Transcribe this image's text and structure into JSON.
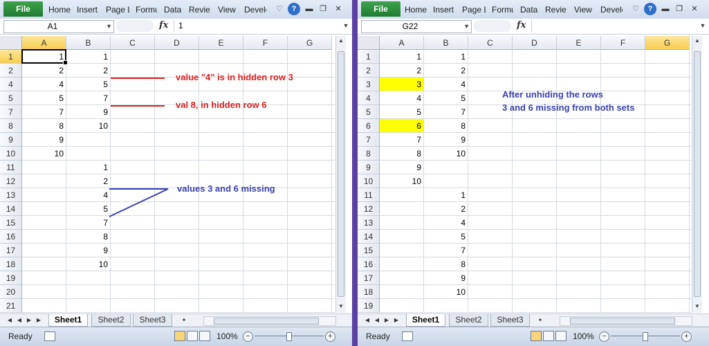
{
  "ribbon": {
    "file_label": "File",
    "tabs": [
      "Home",
      "Insert",
      "Page L",
      "Formu",
      "Data",
      "Review",
      "View",
      "Develo"
    ],
    "help_icon": "?"
  },
  "colors": {
    "highlight": "#ffff00",
    "red_note": "#e02020",
    "blue_note": "#3a3fb0",
    "file_green": "#2e8b3c"
  },
  "left": {
    "name_box": "A1",
    "formula": "1",
    "columns": [
      "A",
      "B",
      "C",
      "D",
      "E",
      "F",
      "G"
    ],
    "rows": [
      "1",
      "2",
      "4",
      "5",
      "7",
      "8",
      "9",
      "10",
      "11",
      "12",
      "13",
      "14",
      "15",
      "16",
      "17",
      "18",
      "19",
      "20",
      "21"
    ],
    "col_a": [
      "1",
      "2",
      "4",
      "5",
      "7",
      "8",
      "9",
      "10",
      "",
      "",
      "",
      "",
      "",
      "",
      "",
      "",
      "",
      "",
      ""
    ],
    "col_b": [
      "1",
      "2",
      "5",
      "7",
      "9",
      "10",
      "",
      "",
      "1",
      "2",
      "4",
      "5",
      "7",
      "8",
      "9",
      "10",
      "",
      "",
      ""
    ],
    "notes": {
      "note1": "value \"4\" is in hidden row 3",
      "note2": "val 8, in hidden row 6",
      "note3": "values 3 and 6 missing"
    },
    "sheets": [
      "Sheet1",
      "Sheet2",
      "Sheet3"
    ],
    "status": "Ready",
    "zoom": "100%"
  },
  "right": {
    "name_box": "G22",
    "formula": "",
    "columns": [
      "A",
      "B",
      "C",
      "D",
      "E",
      "F",
      "G"
    ],
    "rows": [
      "1",
      "2",
      "3",
      "4",
      "5",
      "6",
      "7",
      "8",
      "9",
      "10",
      "11",
      "12",
      "13",
      "14",
      "15",
      "16",
      "17",
      "18",
      "19"
    ],
    "col_a": [
      "1",
      "2",
      "3",
      "4",
      "5",
      "6",
      "7",
      "8",
      "9",
      "10",
      "",
      "",
      "",
      "",
      "",
      "",
      "",
      "",
      ""
    ],
    "col_b": [
      "1",
      "2",
      "4",
      "5",
      "7",
      "8",
      "9",
      "10",
      "",
      "",
      "1",
      "2",
      "4",
      "5",
      "7",
      "8",
      "9",
      "10",
      ""
    ],
    "notes": {
      "line1": "After unhiding the rows",
      "line2": "3 and 6 missing from both sets"
    },
    "sheets": [
      "Sheet1",
      "Sheet2",
      "Sheet3"
    ],
    "status": "Ready",
    "zoom": "100%"
  }
}
